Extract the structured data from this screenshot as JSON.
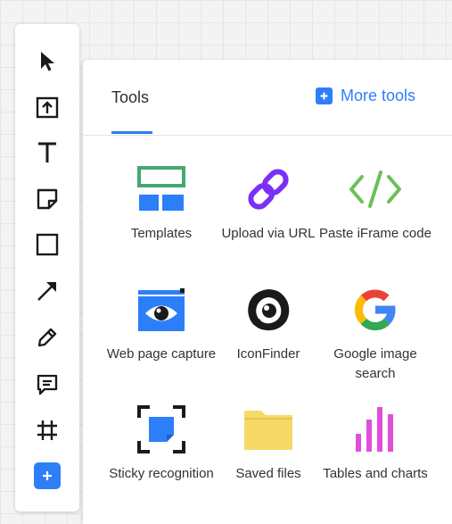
{
  "panel": {
    "tab_title": "Tools",
    "more_tools_label": "More tools"
  },
  "toolbar": {
    "items": [
      "select-pointer-icon",
      "upload-icon",
      "text-icon",
      "sticky-note-icon",
      "rectangle-shape-icon",
      "arrow-line-icon",
      "pencil-icon",
      "comment-icon",
      "frame-icon",
      "plus-icon"
    ]
  },
  "tools": [
    {
      "label": "Templates",
      "icon": "templates-icon"
    },
    {
      "label": "Upload via URL",
      "icon": "link-icon"
    },
    {
      "label": "Paste iFrame code",
      "icon": "code-icon"
    },
    {
      "label": "Web page capture",
      "icon": "web-capture-eye-icon"
    },
    {
      "label": "IconFinder",
      "icon": "iconfinder-logo-icon"
    },
    {
      "label": "Google image search",
      "icon": "google-logo-icon"
    },
    {
      "label": "Sticky recognition",
      "icon": "sticky-recognition-icon"
    },
    {
      "label": "Saved files",
      "icon": "folder-icon"
    },
    {
      "label": "Tables and charts",
      "icon": "bar-chart-icon"
    }
  ],
  "colors": {
    "accent": "#2d7ff9",
    "templates": "#45a86e",
    "link": "#7b2ff7",
    "code": "#6cbf5a",
    "folder": "#f7d968",
    "chart": "#e14fd9"
  }
}
